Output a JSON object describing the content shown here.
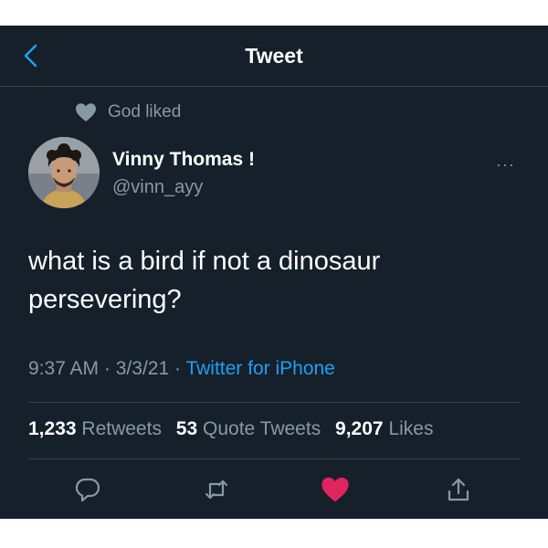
{
  "header": {
    "title": "Tweet"
  },
  "social_context": {
    "text": "God liked"
  },
  "author": {
    "name": "Vinny Thomas !",
    "handle": "@vinn_ayy"
  },
  "tweet": {
    "line1": "what is a bird if not a dinosaur",
    "line2": "persevering?",
    "time": "9:37 AM",
    "date": "3/3/21",
    "separator": "·",
    "source": "Twitter for iPhone"
  },
  "stats": {
    "retweets_count": "1,233",
    "retweets_label": "Retweets",
    "quotes_count": "53",
    "quotes_label": "Quote Tweets",
    "likes_count": "9,207",
    "likes_label": "Likes"
  },
  "more_label": "···",
  "colors": {
    "background": "#15202b",
    "muted": "#8899a6",
    "link": "#1da1f2",
    "like": "#e0245e",
    "divider": "#38444d"
  },
  "icons": [
    "back-icon",
    "heart-icon",
    "more-icon",
    "reply-icon",
    "retweet-icon",
    "like-icon",
    "share-icon"
  ]
}
